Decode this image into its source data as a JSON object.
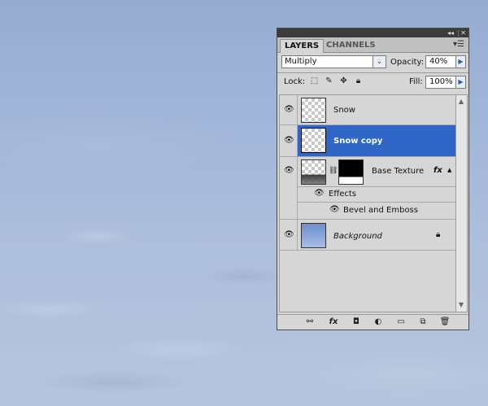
{
  "panel": {
    "tabs": [
      {
        "label": "LAYERS",
        "active": true
      },
      {
        "label": "CHANNELS",
        "active": false
      }
    ],
    "blend_mode": "Multiply",
    "opacity_label": "Opacity:",
    "opacity_value": "40%",
    "lock_label": "Lock:",
    "fill_label": "Fill:",
    "fill_value": "100%"
  },
  "layers": [
    {
      "name": "Snow",
      "selected": false,
      "visible": true
    },
    {
      "name": "Snow copy",
      "selected": true,
      "visible": true
    },
    {
      "name": "Base Texture",
      "selected": false,
      "visible": true,
      "fx": "fx",
      "effects_label": "Effects",
      "effect_item": "Bevel and Emboss"
    },
    {
      "name": "Background",
      "selected": false,
      "visible": true,
      "locked": true
    }
  ],
  "icons": {
    "eye": "eye-icon",
    "lock": "lock-icon",
    "chain": "chain-link-icon",
    "fx_button": "fx"
  },
  "colors": {
    "selection": "#3066c5",
    "panel_bg": "#d6d6d6"
  }
}
